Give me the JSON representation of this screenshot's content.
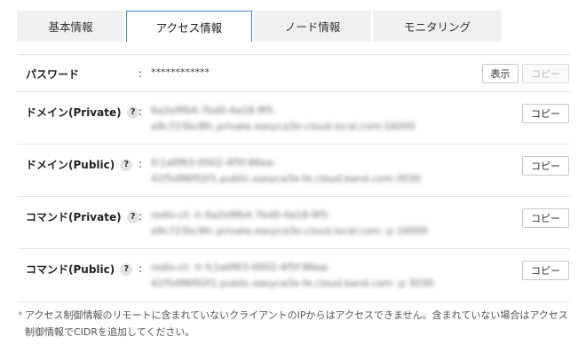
{
  "tabs": [
    {
      "label": "基本情報"
    },
    {
      "label": "アクセス情報"
    },
    {
      "label": "ノード情報"
    },
    {
      "label": "モニタリング"
    }
  ],
  "password": {
    "label": "パスワード",
    "colon": ":",
    "value": "************",
    "show_label": "表示",
    "copy_label": "コピー"
  },
  "rows": [
    {
      "label": "ドメイン(Private)",
      "help": "?",
      "colon": ":",
      "line1": "6a2e9fb4-7bd0-4a18-9f5.",
      "line2": "a9c723bc8fc.private.easyca3e-cloud.local.com:16000",
      "copy_label": "コピー"
    },
    {
      "label": "ドメイン(Public)",
      "help": "?",
      "colon": ":",
      "line1": "fc1a0f63-0002-4f5f-86ea-",
      "line2": "41f5d96f02f1.public.easyca3e-fe.cloud.kand.com:3030",
      "copy_label": "コピー"
    },
    {
      "label": "コマンド(Private)",
      "help": "?",
      "colon": ":",
      "line1": "redis-cli -h 6a2e9fb4-7bd0-4a18-9f5-",
      "line2": "a9c723bc8fc.private.easyca3e-cloud.local.com -p 16000",
      "copy_label": "コピー"
    },
    {
      "label": "コマンド(Public)",
      "help": "?",
      "colon": ":",
      "line1": "redis-cli -h fc1a0f63-0002-4f5f-86ea-",
      "line2": "41f5d96f02f1.public.easyca3e-fe.cloud.kand.com -p 3030",
      "copy_label": "コピー"
    }
  ],
  "note": {
    "mark": "*",
    "text": "アクセス制御情報のリモートに含まれていないクライアントのIPからはアクセスできません。含まれていない場合はアクセス制御情報でCIDRを追加してください。"
  }
}
